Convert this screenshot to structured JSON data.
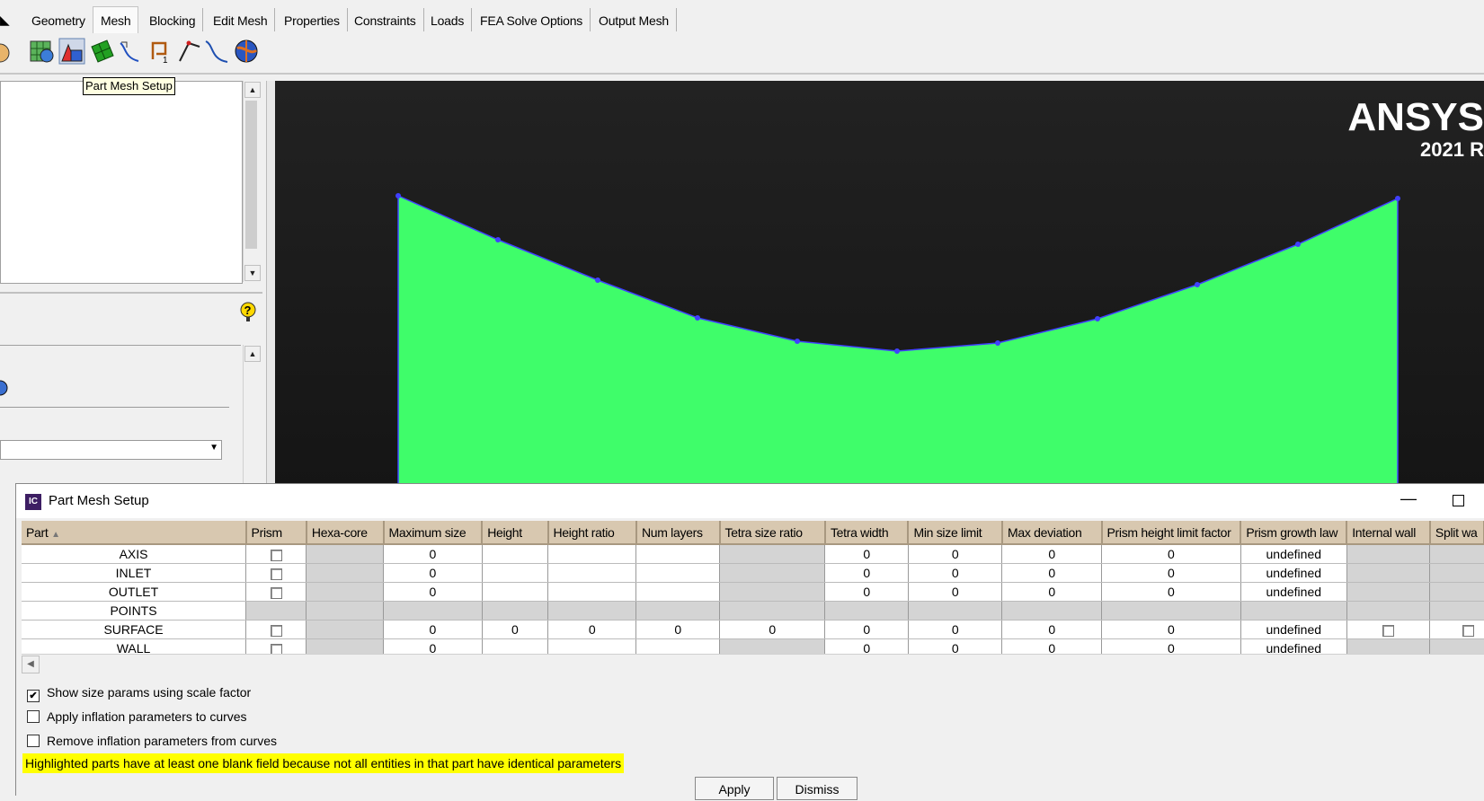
{
  "tabs": [
    "Geometry",
    "Mesh",
    "Blocking",
    "Edit Mesh",
    "Properties",
    "Constraints",
    "Loads",
    "FEA Solve Options",
    "Output Mesh"
  ],
  "active_tab": "Mesh",
  "toolbar": {
    "icons": [
      "global-mesh-setup-icon",
      "part-mesh-setup-icon",
      "surface-mesh-setup-icon",
      "curve-mesh-setup-icon",
      "create-mesh-density-icon",
      "define-connectors-icon",
      "mesh-curve-icon",
      "compute-mesh-icon"
    ],
    "tooltip": "Part Mesh Setup"
  },
  "viewport": {
    "brand_name": "ANSYS",
    "brand_version": "2021 R",
    "fill_color": "#3ffd6a",
    "edge_color": "#4040ff"
  },
  "dialog": {
    "icon_label": "IC",
    "title": "Part Mesh Setup",
    "columns": [
      "Part",
      "Prism",
      "Hexa-core",
      "Maximum size",
      "Height",
      "Height ratio",
      "Num layers",
      "Tetra size ratio",
      "Tetra width",
      "Min size limit",
      "Max deviation",
      "Prism height limit factor",
      "Prism growth law",
      "Internal wall",
      "Split wa"
    ],
    "rows": [
      {
        "part": "AXIS",
        "max_size": "0",
        "height": "",
        "height_ratio": "",
        "num_layers": "",
        "tetra_size_ratio": "",
        "tetra_width": "0",
        "min_size_limit": "0",
        "max_deviation": "0",
        "prism_height_limit": "0",
        "growth_law": "undefined"
      },
      {
        "part": "INLET",
        "max_size": "0",
        "height": "",
        "height_ratio": "",
        "num_layers": "",
        "tetra_size_ratio": "",
        "tetra_width": "0",
        "min_size_limit": "0",
        "max_deviation": "0",
        "prism_height_limit": "0",
        "growth_law": "undefined"
      },
      {
        "part": "OUTLET",
        "max_size": "0",
        "height": "",
        "height_ratio": "",
        "num_layers": "",
        "tetra_size_ratio": "",
        "tetra_width": "0",
        "min_size_limit": "0",
        "max_deviation": "0",
        "prism_height_limit": "0",
        "growth_law": "undefined"
      },
      {
        "part": "POINTS",
        "max_size": "",
        "height": "",
        "height_ratio": "",
        "num_layers": "",
        "tetra_size_ratio": "",
        "tetra_width": "",
        "min_size_limit": "",
        "max_deviation": "",
        "prism_height_limit": "",
        "growth_law": ""
      },
      {
        "part": "SURFACE",
        "max_size": "0",
        "height": "0",
        "height_ratio": "0",
        "num_layers": "0",
        "tetra_size_ratio": "0",
        "tetra_width": "0",
        "min_size_limit": "0",
        "max_deviation": "0",
        "prism_height_limit": "0",
        "growth_law": "undefined"
      },
      {
        "part": "WALL",
        "max_size": "0",
        "height": "",
        "height_ratio": "",
        "num_layers": "",
        "tetra_size_ratio": "",
        "tetra_width": "0",
        "min_size_limit": "0",
        "max_deviation": "0",
        "prism_height_limit": "0",
        "growth_law": "undefined"
      }
    ],
    "options": [
      {
        "label": "Show size params using scale factor",
        "checked": true
      },
      {
        "label": "Apply inflation parameters to curves",
        "checked": false
      },
      {
        "label": "Remove inflation parameters from curves",
        "checked": false
      }
    ],
    "note": "Highlighted parts have at least one blank field because not all entities in that part have identical parameters",
    "apply_label": "Apply",
    "dismiss_label": "Dismiss"
  }
}
